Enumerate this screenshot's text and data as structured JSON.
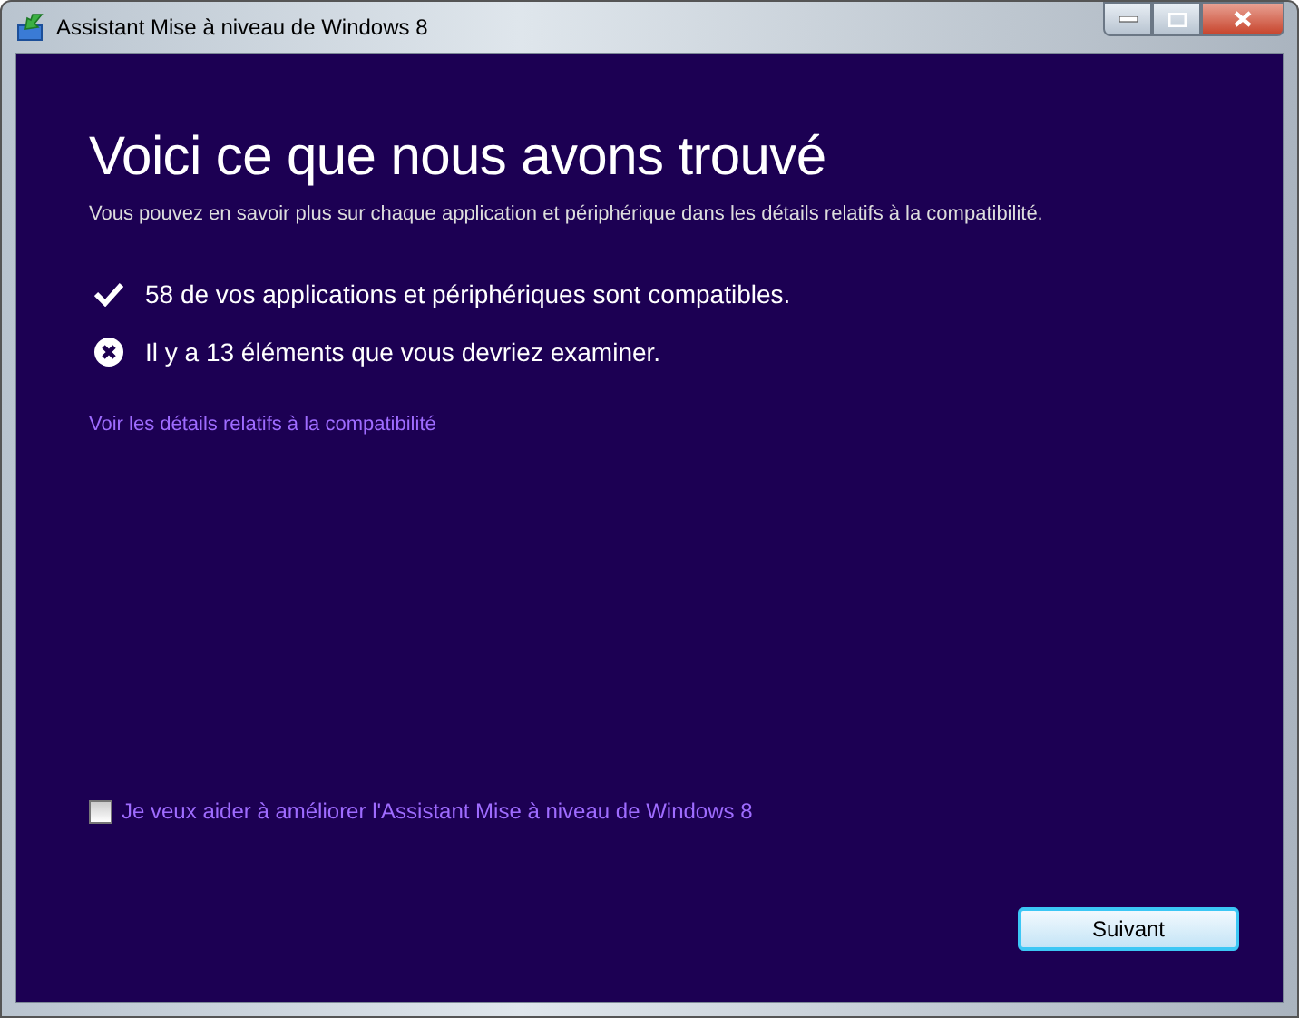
{
  "window": {
    "title": "Assistant Mise à niveau de Windows 8"
  },
  "heading": "Voici ce que nous avons trouvé",
  "subtitle": "Vous pouvez en savoir plus sur chaque application et périphérique dans les détails relatifs à la compatibilité.",
  "results": [
    {
      "kind": "ok",
      "text": "58 de vos applications et périphériques sont compatibles."
    },
    {
      "kind": "issue",
      "text": "Il y a 13 éléments que vous devriez examiner."
    }
  ],
  "details_link": "Voir les détails relatifs à la compatibilité",
  "feedback_checkbox": {
    "label": "Je veux aider à améliorer l'Assistant Mise à niveau de Windows 8",
    "checked": false
  },
  "buttons": [
    "Suivant"
  ]
}
